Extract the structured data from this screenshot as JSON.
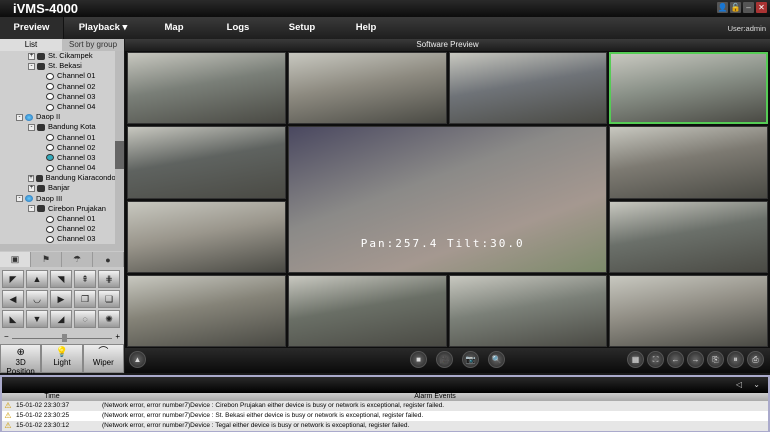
{
  "app": {
    "title": "iVMS-4000",
    "window_buttons": [
      "user-icon",
      "lock-icon",
      "minimize-icon",
      "close-icon"
    ]
  },
  "menu": {
    "items": [
      "Preview",
      "Playback ▾",
      "Map",
      "Logs",
      "Setup",
      "Help"
    ],
    "active": "Preview",
    "user": "User:admin"
  },
  "left": {
    "tabs": [
      "List",
      "Sort by group"
    ],
    "tree": [
      {
        "label": "St. Cikampek",
        "level": 2,
        "type": "device",
        "exp": "+"
      },
      {
        "label": "St. Bekasi",
        "level": 2,
        "type": "device",
        "exp": "-"
      },
      {
        "label": "Channel 01",
        "level": 3,
        "type": "camera"
      },
      {
        "label": "Channel 02",
        "level": 3,
        "type": "camera"
      },
      {
        "label": "Channel 03",
        "level": 3,
        "type": "camera"
      },
      {
        "label": "Channel 04",
        "level": 3,
        "type": "camera"
      },
      {
        "label": "Daop II",
        "level": 1,
        "type": "globe",
        "exp": "-"
      },
      {
        "label": "Bandung Kota",
        "level": 2,
        "type": "device",
        "exp": "-"
      },
      {
        "label": "Channel 01",
        "level": 3,
        "type": "camera"
      },
      {
        "label": "Channel 02",
        "level": 3,
        "type": "camera"
      },
      {
        "label": "Channel 03",
        "level": 3,
        "type": "camera",
        "selected": true
      },
      {
        "label": "Channel 04",
        "level": 3,
        "type": "camera"
      },
      {
        "label": "Bandung Kiaracondong",
        "level": 2,
        "type": "device",
        "exp": "+"
      },
      {
        "label": "Banjar",
        "level": 2,
        "type": "device",
        "exp": "+"
      },
      {
        "label": "Daop III",
        "level": 1,
        "type": "globe",
        "exp": "-"
      },
      {
        "label": "Cirebon Prujakan",
        "level": 2,
        "type": "device",
        "exp": "-"
      },
      {
        "label": "Channel 01",
        "level": 3,
        "type": "camera"
      },
      {
        "label": "Channel 02",
        "level": 3,
        "type": "camera"
      },
      {
        "label": "Channel 03",
        "level": 3,
        "type": "camera"
      }
    ],
    "ptz_tabs": [
      "▣",
      "⚑",
      "☂",
      "●"
    ],
    "ptz_grid": [
      "◤",
      "▲",
      "◥",
      "⇞",
      "⋕",
      "◀",
      "◡",
      "▶",
      "❐",
      "❏",
      "◣",
      "▼",
      "◢",
      "◌",
      "✺"
    ],
    "zoom_minus": "−",
    "zoom_plus": "+",
    "ptz_buttons": [
      {
        "glyph": "⊕",
        "label": "3D Position"
      },
      {
        "glyph": "💡",
        "label": "Light"
      },
      {
        "glyph": "⌒",
        "label": "Wiper"
      }
    ]
  },
  "preview": {
    "title": "Software Preview",
    "ptz_osd": "Pan:257.4 Tilt:30.0",
    "toolbar_center": [
      "■",
      "🎥",
      "📷",
      "🔍"
    ],
    "toolbar_right": [
      "▦",
      "⛶",
      "←",
      "→",
      "⎘",
      "⏸",
      "⎙"
    ]
  },
  "alarm": {
    "columns": [
      "Time",
      "Alarm Events"
    ],
    "rows": [
      {
        "time": "15-01-02 23:30:37",
        "event": "(Network error, error number7)Device : Cirebon Prujakan  either device is busy or network is exceptional, register failed."
      },
      {
        "time": "15-01-02 23:30:25",
        "event": "(Network error, error number7)Device : St. Bekasi  either device is busy or network is exceptional, register failed."
      },
      {
        "time": "15-01-02 23:30:12",
        "event": "(Network error, error number7)Device : Tegal  either device is busy or network is exceptional, register failed."
      }
    ]
  }
}
